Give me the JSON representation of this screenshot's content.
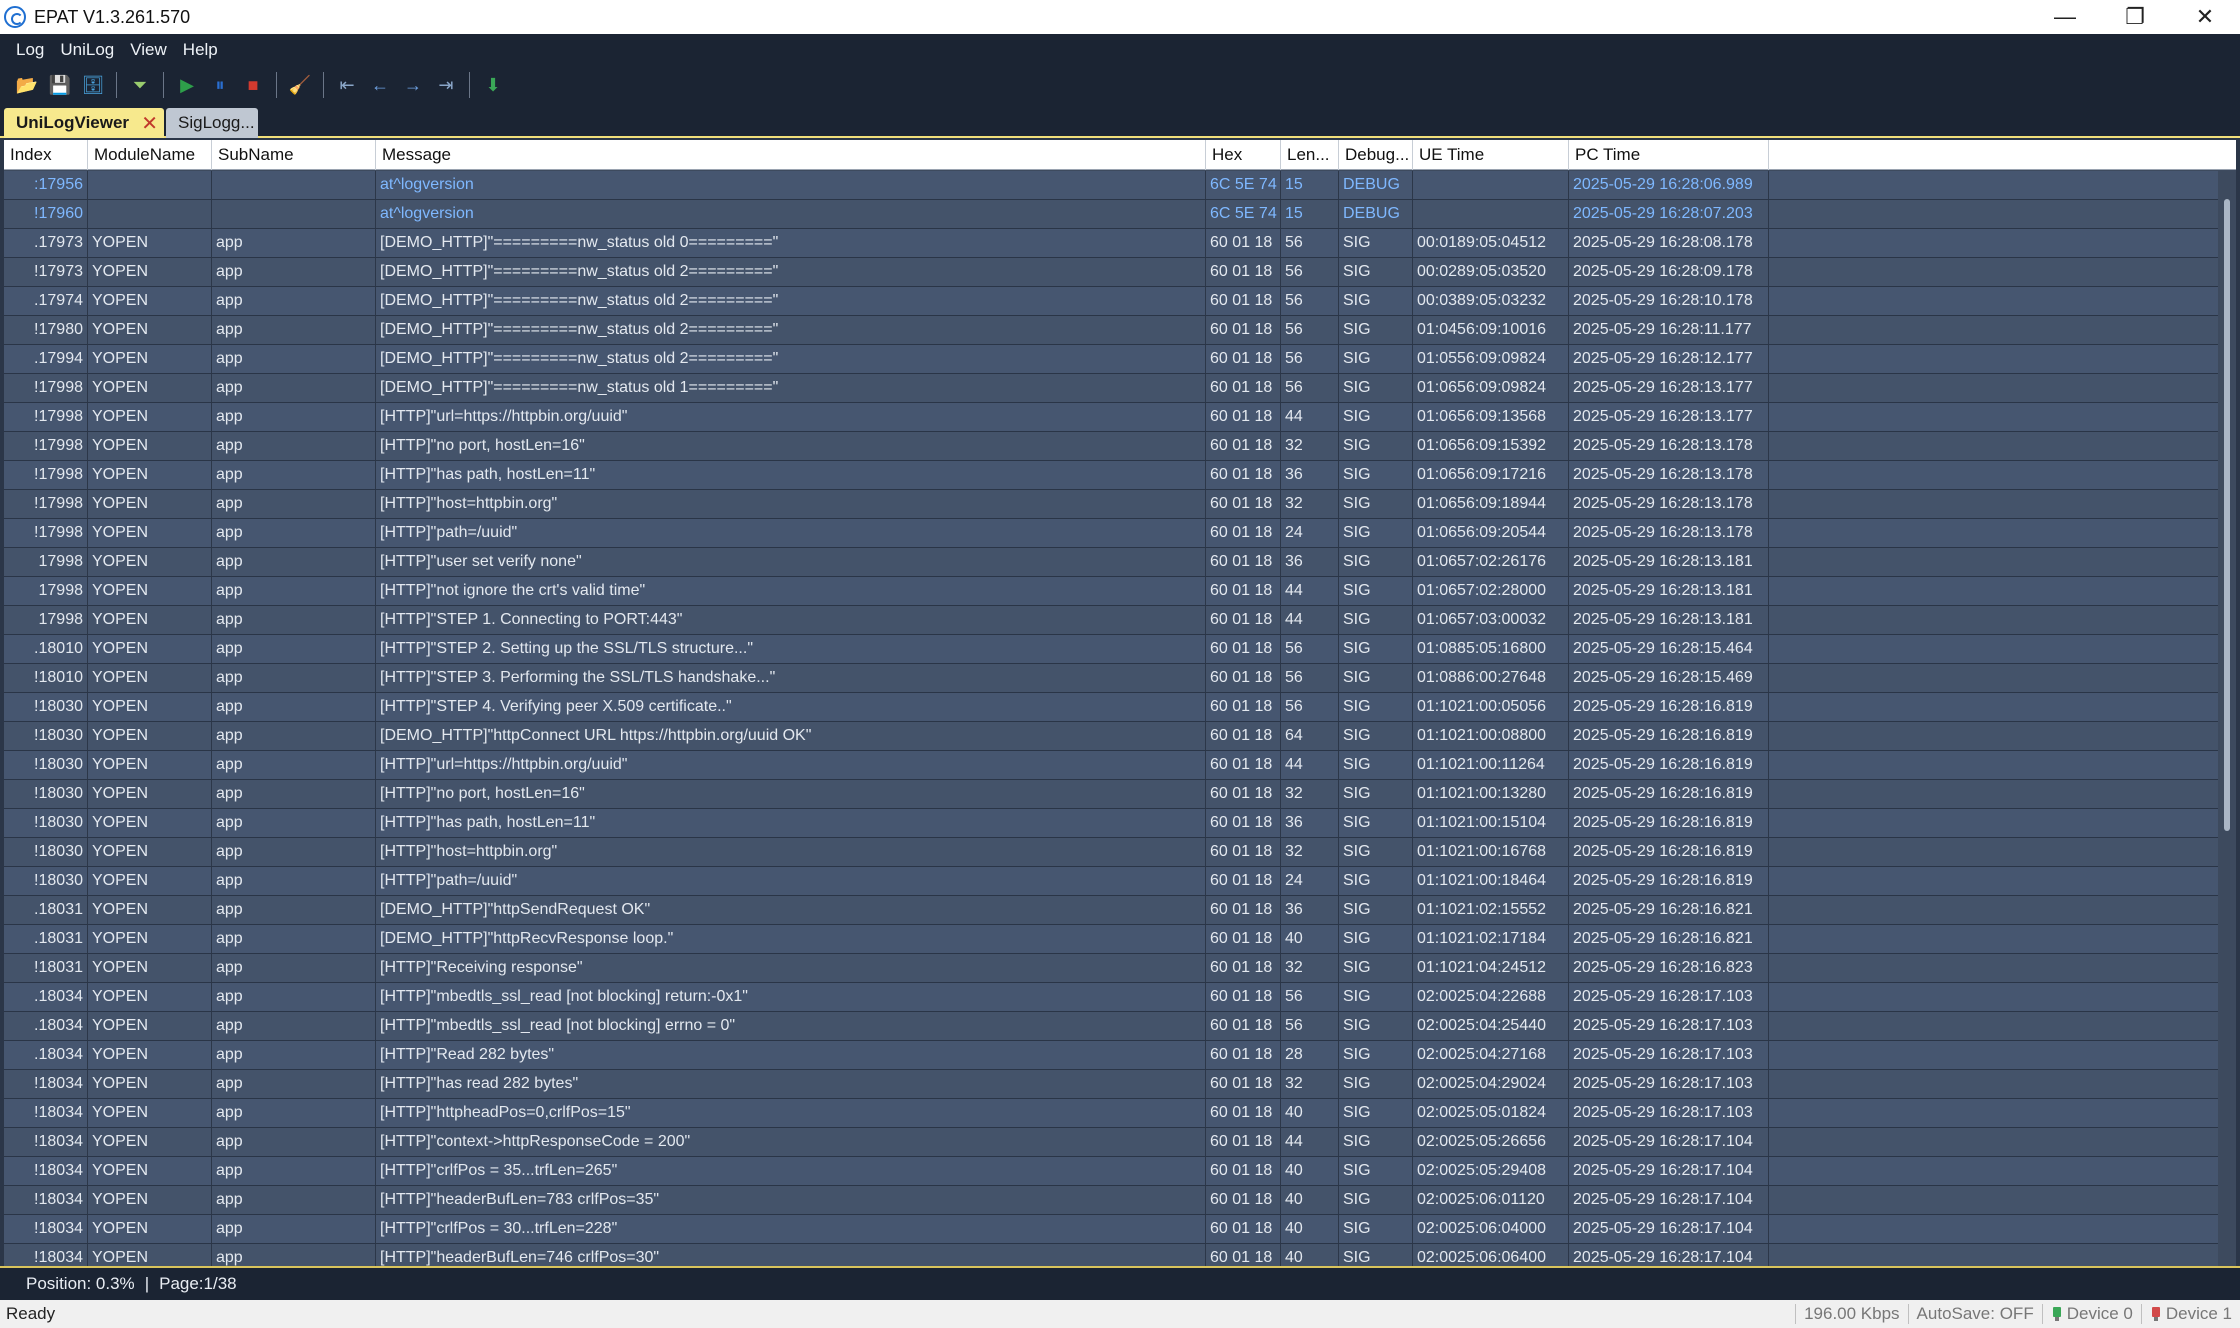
{
  "window": {
    "title": "EPAT V1.3.261.570",
    "minimize": "—",
    "restore": "❐",
    "close": "✕"
  },
  "menu": [
    "Log",
    "UniLog",
    "View",
    "Help"
  ],
  "toolbar": {
    "icons": [
      {
        "name": "open-log-icon",
        "glyph": "📂",
        "color": "#8fa0b5"
      },
      {
        "name": "save-log-icon",
        "glyph": "💾",
        "color": "#e2b53a"
      },
      {
        "name": "database-icon",
        "glyph": "🗄",
        "color": "#4aa3df"
      },
      {
        "name": "filter-icon",
        "glyph": "⏷",
        "color": "#9acd6e"
      },
      {
        "name": "play-icon",
        "glyph": "▶",
        "color": "#2e9e4a"
      },
      {
        "name": "pause-icon",
        "glyph": "⏸",
        "color": "#2a6fd1"
      },
      {
        "name": "stop-icon",
        "glyph": "■",
        "color": "#d23a2f"
      },
      {
        "name": "clear-icon",
        "glyph": "🧹",
        "color": "#e8c25a"
      },
      {
        "name": "first-page-icon",
        "glyph": "⇤",
        "color": "#8aa6c8"
      },
      {
        "name": "previous-page-icon",
        "glyph": "←",
        "color": "#6ea0e0"
      },
      {
        "name": "next-page-icon",
        "glyph": "→",
        "color": "#6ea0e0"
      },
      {
        "name": "last-page-icon",
        "glyph": "⇥",
        "color": "#8aa6c8"
      },
      {
        "name": "download-icon",
        "glyph": "⬇",
        "color": "#3aa757"
      }
    ]
  },
  "tabs": [
    {
      "label": "UniLogViewer",
      "active": true
    },
    {
      "label": "SigLogg...",
      "active": false
    }
  ],
  "columns": [
    "Index",
    "ModuleName",
    "SubName",
    "Message",
    "Hex",
    "Len...",
    "Debug...",
    "UE Time",
    "PC Time"
  ],
  "rows": [
    {
      "index": "17956:",
      "module": "",
      "sub": "",
      "msg": "at^logversion",
      "hex": "6C 5E 74",
      "len": "15",
      "dbg": "DEBUG",
      "ue": "",
      "pc": "2025-05-29 16:28:06.989",
      "debug": true
    },
    {
      "index": "17960!",
      "module": "",
      "sub": "",
      "msg": "at^logversion",
      "hex": "6C 5E 74",
      "len": "15",
      "dbg": "DEBUG",
      "ue": "",
      "pc": "2025-05-29 16:28:07.203",
      "debug": true
    },
    {
      "index": "17973.",
      "module": "YOPEN",
      "sub": "app",
      "msg": "[DEMO_HTTP]\"=========nw_status old 0=========\"",
      "hex": "60 01 18",
      "len": "56",
      "dbg": "SIG",
      "ue": "00:0189:05:04512",
      "pc": "2025-05-29 16:28:08.178"
    },
    {
      "index": "17973!",
      "module": "YOPEN",
      "sub": "app",
      "msg": "[DEMO_HTTP]\"=========nw_status old 2=========\"",
      "hex": "60 01 18",
      "len": "56",
      "dbg": "SIG",
      "ue": "00:0289:05:03520",
      "pc": "2025-05-29 16:28:09.178"
    },
    {
      "index": "17974.",
      "module": "YOPEN",
      "sub": "app",
      "msg": "[DEMO_HTTP]\"=========nw_status old 2=========\"",
      "hex": "60 01 18",
      "len": "56",
      "dbg": "SIG",
      "ue": "00:0389:05:03232",
      "pc": "2025-05-29 16:28:10.178"
    },
    {
      "index": "17980!",
      "module": "YOPEN",
      "sub": "app",
      "msg": "[DEMO_HTTP]\"=========nw_status old 2=========\"",
      "hex": "60 01 18",
      "len": "56",
      "dbg": "SIG",
      "ue": "01:0456:09:10016",
      "pc": "2025-05-29 16:28:11.177"
    },
    {
      "index": "17994.",
      "module": "YOPEN",
      "sub": "app",
      "msg": "[DEMO_HTTP]\"=========nw_status old 2=========\"",
      "hex": "60 01 18",
      "len": "56",
      "dbg": "SIG",
      "ue": "01:0556:09:09824",
      "pc": "2025-05-29 16:28:12.177"
    },
    {
      "index": "17998!",
      "module": "YOPEN",
      "sub": "app",
      "msg": "[DEMO_HTTP]\"=========nw_status old 1=========\"",
      "hex": "60 01 18",
      "len": "56",
      "dbg": "SIG",
      "ue": "01:0656:09:09824",
      "pc": "2025-05-29 16:28:13.177"
    },
    {
      "index": "17998!",
      "module": "YOPEN",
      "sub": "app",
      "msg": "[HTTP]\"url=https://httpbin.org/uuid\"",
      "hex": "60 01 18",
      "len": "44",
      "dbg": "SIG",
      "ue": "01:0656:09:13568",
      "pc": "2025-05-29 16:28:13.177"
    },
    {
      "index": "17998!",
      "module": "YOPEN",
      "sub": "app",
      "msg": "[HTTP]\"no port, hostLen=16\"",
      "hex": "60 01 18",
      "len": "32",
      "dbg": "SIG",
      "ue": "01:0656:09:15392",
      "pc": "2025-05-29 16:28:13.178"
    },
    {
      "index": "17998!",
      "module": "YOPEN",
      "sub": "app",
      "msg": "[HTTP]\"has path, hostLen=11\"",
      "hex": "60 01 18",
      "len": "36",
      "dbg": "SIG",
      "ue": "01:0656:09:17216",
      "pc": "2025-05-29 16:28:13.178"
    },
    {
      "index": "17998!",
      "module": "YOPEN",
      "sub": "app",
      "msg": "[HTTP]\"host=httpbin.org\"",
      "hex": "60 01 18",
      "len": "32",
      "dbg": "SIG",
      "ue": "01:0656:09:18944",
      "pc": "2025-05-29 16:28:13.178"
    },
    {
      "index": "17998!",
      "module": "YOPEN",
      "sub": "app",
      "msg": "[HTTP]\"path=/uuid\"",
      "hex": "60 01 18",
      "len": "24",
      "dbg": "SIG",
      "ue": "01:0656:09:20544",
      "pc": "2025-05-29 16:28:13.178"
    },
    {
      "index": "17998",
      "module": "YOPEN",
      "sub": "app",
      "msg": "[HTTP]\"user set verify none\"",
      "hex": "60 01 18",
      "len": "36",
      "dbg": "SIG",
      "ue": "01:0657:02:26176",
      "pc": "2025-05-29 16:28:13.181"
    },
    {
      "index": "17998",
      "module": "YOPEN",
      "sub": "app",
      "msg": "[HTTP]\"not ignore the crt's valid time\"",
      "hex": "60 01 18",
      "len": "44",
      "dbg": "SIG",
      "ue": "01:0657:02:28000",
      "pc": "2025-05-29 16:28:13.181"
    },
    {
      "index": "17998",
      "module": "YOPEN",
      "sub": "app",
      "msg": "[HTTP]\"STEP 1. Connecting to PORT:443\"",
      "hex": "60 01 18",
      "len": "44",
      "dbg": "SIG",
      "ue": "01:0657:03:00032",
      "pc": "2025-05-29 16:28:13.181"
    },
    {
      "index": "18010.",
      "module": "YOPEN",
      "sub": "app",
      "msg": "[HTTP]\"STEP 2. Setting up the SSL/TLS structure...\"",
      "hex": "60 01 18",
      "len": "56",
      "dbg": "SIG",
      "ue": "01:0885:05:16800",
      "pc": "2025-05-29 16:28:15.464"
    },
    {
      "index": "18010!",
      "module": "YOPEN",
      "sub": "app",
      "msg": "[HTTP]\"STEP 3. Performing the SSL/TLS handshake...\"",
      "hex": "60 01 18",
      "len": "56",
      "dbg": "SIG",
      "ue": "01:0886:00:27648",
      "pc": "2025-05-29 16:28:15.469"
    },
    {
      "index": "18030!",
      "module": "YOPEN",
      "sub": "app",
      "msg": "[HTTP]\"STEP 4. Verifying peer X.509 certificate..\"",
      "hex": "60 01 18",
      "len": "56",
      "dbg": "SIG",
      "ue": "01:1021:00:05056",
      "pc": "2025-05-29 16:28:16.819"
    },
    {
      "index": "18030!",
      "module": "YOPEN",
      "sub": "app",
      "msg": "[DEMO_HTTP]\"httpConnect URL https://httpbin.org/uuid OK\"",
      "hex": "60 01 18",
      "len": "64",
      "dbg": "SIG",
      "ue": "01:1021:00:08800",
      "pc": "2025-05-29 16:28:16.819"
    },
    {
      "index": "18030!",
      "module": "YOPEN",
      "sub": "app",
      "msg": "[HTTP]\"url=https://httpbin.org/uuid\"",
      "hex": "60 01 18",
      "len": "44",
      "dbg": "SIG",
      "ue": "01:1021:00:11264",
      "pc": "2025-05-29 16:28:16.819"
    },
    {
      "index": "18030!",
      "module": "YOPEN",
      "sub": "app",
      "msg": "[HTTP]\"no port, hostLen=16\"",
      "hex": "60 01 18",
      "len": "32",
      "dbg": "SIG",
      "ue": "01:1021:00:13280",
      "pc": "2025-05-29 16:28:16.819"
    },
    {
      "index": "18030!",
      "module": "YOPEN",
      "sub": "app",
      "msg": "[HTTP]\"has path, hostLen=11\"",
      "hex": "60 01 18",
      "len": "36",
      "dbg": "SIG",
      "ue": "01:1021:00:15104",
      "pc": "2025-05-29 16:28:16.819"
    },
    {
      "index": "18030!",
      "module": "YOPEN",
      "sub": "app",
      "msg": "[HTTP]\"host=httpbin.org\"",
      "hex": "60 01 18",
      "len": "32",
      "dbg": "SIG",
      "ue": "01:1021:00:16768",
      "pc": "2025-05-29 16:28:16.819"
    },
    {
      "index": "18030!",
      "module": "YOPEN",
      "sub": "app",
      "msg": "[HTTP]\"path=/uuid\"",
      "hex": "60 01 18",
      "len": "24",
      "dbg": "SIG",
      "ue": "01:1021:00:18464",
      "pc": "2025-05-29 16:28:16.819"
    },
    {
      "index": "18031.",
      "module": "YOPEN",
      "sub": "app",
      "msg": "[DEMO_HTTP]\"httpSendRequest OK\"",
      "hex": "60 01 18",
      "len": "36",
      "dbg": "SIG",
      "ue": "01:1021:02:15552",
      "pc": "2025-05-29 16:28:16.821"
    },
    {
      "index": "18031.",
      "module": "YOPEN",
      "sub": "app",
      "msg": "[DEMO_HTTP]\"httpRecvResponse loop.\"",
      "hex": "60 01 18",
      "len": "40",
      "dbg": "SIG",
      "ue": "01:1021:02:17184",
      "pc": "2025-05-29 16:28:16.821"
    },
    {
      "index": "18031!",
      "module": "YOPEN",
      "sub": "app",
      "msg": "[HTTP]\"Receiving response\"",
      "hex": "60 01 18",
      "len": "32",
      "dbg": "SIG",
      "ue": "01:1021:04:24512",
      "pc": "2025-05-29 16:28:16.823"
    },
    {
      "index": "18034.",
      "module": "YOPEN",
      "sub": "app",
      "msg": "[HTTP]\"mbedtls_ssl_read [not blocking] return:-0x1\"",
      "hex": "60 01 18",
      "len": "56",
      "dbg": "SIG",
      "ue": "02:0025:04:22688",
      "pc": "2025-05-29 16:28:17.103"
    },
    {
      "index": "18034.",
      "module": "YOPEN",
      "sub": "app",
      "msg": "[HTTP]\"mbedtls_ssl_read [not blocking] errno = 0\"",
      "hex": "60 01 18",
      "len": "56",
      "dbg": "SIG",
      "ue": "02:0025:04:25440",
      "pc": "2025-05-29 16:28:17.103"
    },
    {
      "index": "18034.",
      "module": "YOPEN",
      "sub": "app",
      "msg": "[HTTP]\"Read 282 bytes\"",
      "hex": "60 01 18",
      "len": "28",
      "dbg": "SIG",
      "ue": "02:0025:04:27168",
      "pc": "2025-05-29 16:28:17.103"
    },
    {
      "index": "18034!",
      "module": "YOPEN",
      "sub": "app",
      "msg": "[HTTP]\"has read 282 bytes\"",
      "hex": "60 01 18",
      "len": "32",
      "dbg": "SIG",
      "ue": "02:0025:04:29024",
      "pc": "2025-05-29 16:28:17.103"
    },
    {
      "index": "18034!",
      "module": "YOPEN",
      "sub": "app",
      "msg": "[HTTP]\"httpheadPos=0,crlfPos=15\"",
      "hex": "60 01 18",
      "len": "40",
      "dbg": "SIG",
      "ue": "02:0025:05:01824",
      "pc": "2025-05-29 16:28:17.103"
    },
    {
      "index": "18034!",
      "module": "YOPEN",
      "sub": "app",
      "msg": "[HTTP]\"context->httpResponseCode = 200\"",
      "hex": "60 01 18",
      "len": "44",
      "dbg": "SIG",
      "ue": "02:0025:05:26656",
      "pc": "2025-05-29 16:28:17.104"
    },
    {
      "index": "18034!",
      "module": "YOPEN",
      "sub": "app",
      "msg": "[HTTP]\"crlfPos = 35...trfLen=265\"",
      "hex": "60 01 18",
      "len": "40",
      "dbg": "SIG",
      "ue": "02:0025:05:29408",
      "pc": "2025-05-29 16:28:17.104"
    },
    {
      "index": "18034!",
      "module": "YOPEN",
      "sub": "app",
      "msg": "[HTTP]\"headerBufLen=783 crlfPos=35\"",
      "hex": "60 01 18",
      "len": "40",
      "dbg": "SIG",
      "ue": "02:0025:06:01120",
      "pc": "2025-05-29 16:28:17.104"
    },
    {
      "index": "18034!",
      "module": "YOPEN",
      "sub": "app",
      "msg": "[HTTP]\"crlfPos = 30...trfLen=228\"",
      "hex": "60 01 18",
      "len": "40",
      "dbg": "SIG",
      "ue": "02:0025:06:04000",
      "pc": "2025-05-29 16:28:17.104"
    },
    {
      "index": "18034!",
      "module": "YOPEN",
      "sub": "app",
      "msg": "[HTTP]\"headerBufLen=746 crlfPos=30\"",
      "hex": "60 01 18",
      "len": "40",
      "dbg": "SIG",
      "ue": "02:0025:06:06400",
      "pc": "2025-05-29 16:28:17.104"
    }
  ],
  "position": {
    "position_text": "Position: 0.3%",
    "separator": "|",
    "page_text": "Page:1/38"
  },
  "status": {
    "left": "Ready",
    "rate": "196.00 Kbps",
    "autosave": "AutoSave: OFF",
    "device0": "Device 0",
    "device1": "Device 1"
  }
}
